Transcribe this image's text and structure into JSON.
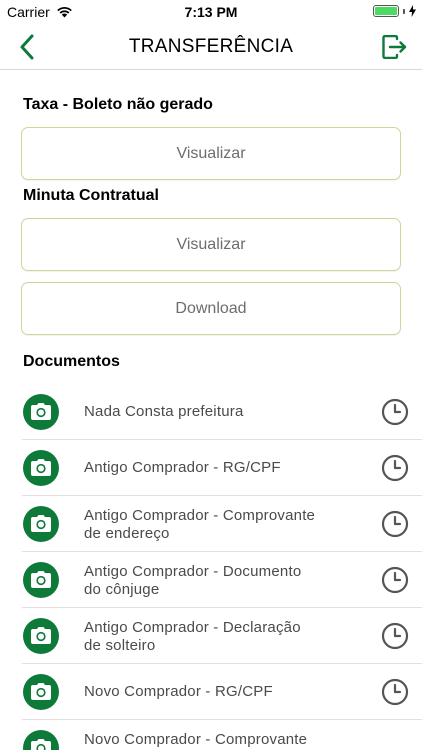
{
  "status_bar": {
    "carrier": "Carrier",
    "time": "7:13 PM",
    "battery_color": "#4cd964"
  },
  "nav": {
    "title": "TRANSFERÊNCIA",
    "back_icon": "chevron-left-icon",
    "exit_icon": "exit-icon",
    "accent": "#0e7a3a"
  },
  "sections": {
    "taxa": {
      "title": "Taxa - Boleto não gerado",
      "view_button": "Visualizar"
    },
    "minuta": {
      "title": "Minuta Contratual",
      "view_button": "Visualizar",
      "download_button": "Download"
    },
    "documentos": {
      "title": "Documentos"
    }
  },
  "documents": [
    {
      "line1": "Nada Consta prefeitura",
      "line2": ""
    },
    {
      "line1": "Antigo Comprador - RG/CPF",
      "line2": ""
    },
    {
      "line1": "Antigo Comprador - Comprovante",
      "line2": "de endereço"
    },
    {
      "line1": "Antigo Comprador - Documento",
      "line2": "do cônjuge"
    },
    {
      "line1": "Antigo Comprador - Declaração",
      "line2": "de solteiro"
    },
    {
      "line1": "Novo Comprador - RG/CPF",
      "line2": ""
    },
    {
      "line1": "Novo Comprador - Comprovante",
      "line2": ""
    }
  ],
  "colors": {
    "button_border": "#c8d99a",
    "camera_bg": "#0e7a3a"
  }
}
